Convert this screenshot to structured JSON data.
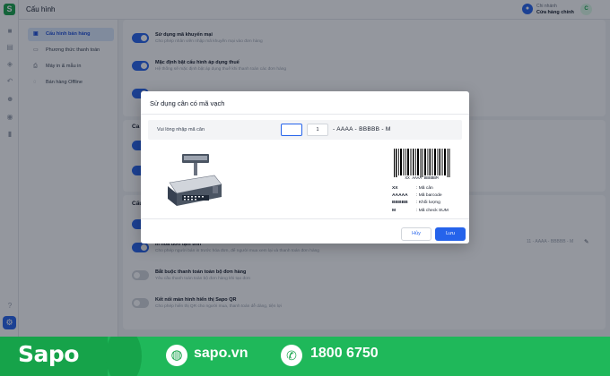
{
  "header": {
    "title": "Cấu hình",
    "branch_label": "Chi nhánh",
    "branch_value": "Cửa hàng chính",
    "avatar_initial": "C"
  },
  "subnav": {
    "items": [
      {
        "label": "Cấu hình bán hàng",
        "icon": "cart-icon",
        "active": true
      },
      {
        "label": "Phương thức thanh toán",
        "icon": "card-icon",
        "active": false
      },
      {
        "label": "Máy in & mẫu in",
        "icon": "printer-icon",
        "active": false
      },
      {
        "label": "Bán hàng Offline",
        "icon": "wifi-off-icon",
        "active": false
      }
    ]
  },
  "settings": {
    "promo": {
      "title": "Sử dụng mã khuyến mại",
      "desc": "Cho phép nhân viên nhập mã khuyến mại vào đơn hàng"
    },
    "default_tax": {
      "title": "Mặc định bật cấu hình áp dụng thuế",
      "desc": "Hệ thống sẽ mặc định bật áp dụng thuế khi thanh toán các đơn hàng"
    },
    "section2_heading": "Ca bán",
    "section3_heading": "Cấu",
    "scale_format": "11 - AAAA - BBBBB - M",
    "print_draft": {
      "title": "In hóa đơn tạm tính",
      "desc": "Cho phép người bán in trước hóa đơn, để người mua xem lại và thanh toán đơn hàng"
    },
    "require_full_payment": {
      "title": "Bắt buộc thanh toán toàn bộ đơn hàng",
      "desc": "Yêu cầu thanh toán toàn bộ đơn hàng khi tạo đơn"
    },
    "sapo_qr": {
      "title": "Kết nối màn hình hiển thị Sapo QR",
      "desc": "Cho phép hiển thị QR cho người mua, thanh toán dễ dàng, tiện lợi"
    }
  },
  "modal": {
    "title": "Sử dụng cân có mã vạch",
    "input_label": "Vui lòng nhập mã cân",
    "input1_value": "",
    "input2_value": "1",
    "format": "- AAAA - BBBBB - M",
    "barcode_caption": "XX AAAA BBBBBM",
    "legend": [
      {
        "key": "XX",
        "value": ": Mã cân"
      },
      {
        "key": "AAAAA",
        "value": ": Mã barcode"
      },
      {
        "key": "BBBBB",
        "value": ": Khối lượng"
      },
      {
        "key": "M",
        "value": ": Mã check SUM"
      }
    ],
    "cancel_label": "Hủy",
    "save_label": "Lưu"
  },
  "banner": {
    "brand": "Sapo",
    "website": "sapo.vn",
    "phone": "1800 6750"
  },
  "colors": {
    "primary": "#2563eb",
    "brand_green": "#16a34a"
  }
}
